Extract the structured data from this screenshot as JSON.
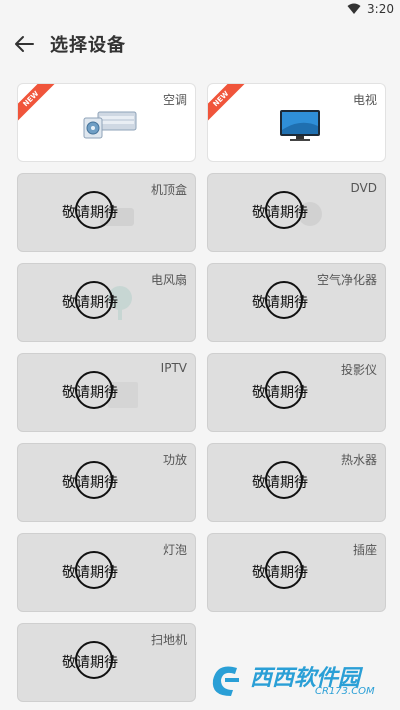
{
  "status_bar": {
    "time": "3:20"
  },
  "header": {
    "title": "选择设备"
  },
  "devices": [
    {
      "label": "空调",
      "badge": "NEW",
      "state": "active"
    },
    {
      "label": "电视",
      "badge": "NEW",
      "state": "active"
    },
    {
      "label": "机顶盒",
      "state": "disabled",
      "overlay": "敬请期待"
    },
    {
      "label": "DVD",
      "state": "disabled",
      "overlay": "敬请期待"
    },
    {
      "label": "电风扇",
      "state": "disabled",
      "overlay": "敬请期待"
    },
    {
      "label": "空气净化器",
      "state": "disabled",
      "overlay": "敬请期待"
    },
    {
      "label": "IPTV",
      "state": "disabled",
      "overlay": "敬请期待"
    },
    {
      "label": "投影仪",
      "state": "disabled",
      "overlay": "敬请期待"
    },
    {
      "label": "功放",
      "state": "disabled",
      "overlay": "敬请期待"
    },
    {
      "label": "热水器",
      "state": "disabled",
      "overlay": "敬请期待"
    },
    {
      "label": "灯泡",
      "state": "disabled",
      "overlay": "敬请期待"
    },
    {
      "label": "插座",
      "state": "disabled",
      "overlay": "敬请期待"
    },
    {
      "label": "扫地机",
      "state": "disabled",
      "overlay": "敬请期待"
    }
  ],
  "watermark": {
    "brand": "西西软件园",
    "url": "CR173.COM"
  },
  "colors": {
    "badge": "#f0553b",
    "disabled_bg": "#dedede",
    "active_bg": "#ffffff",
    "watermark": "#2a9fd6"
  }
}
